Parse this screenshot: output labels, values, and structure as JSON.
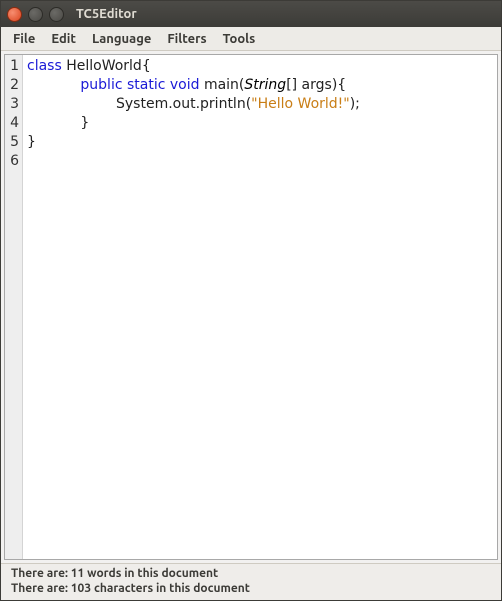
{
  "window": {
    "title": "TC5Editor"
  },
  "menu": {
    "file": "File",
    "edit": "Edit",
    "language": "Language",
    "filters": "Filters",
    "tools": "Tools"
  },
  "editor": {
    "line_numbers": [
      "1",
      "2",
      "3",
      "4",
      "5",
      "6"
    ],
    "code": {
      "l1_kw": "class",
      "l1_rest": " HelloWorld{",
      "l2": "",
      "l3_pad": "            ",
      "l3_kw": "public static void",
      "l3_main": " main(",
      "l3_typ": "String",
      "l3_after": "[] args){",
      "l4_pad": "                    System.out.println(",
      "l4_str": "\"Hello World!\"",
      "l4_after": ");",
      "l5": "            }",
      "l6": "}"
    }
  },
  "status": {
    "words": "There are: 11 words in this document",
    "chars": "There are: 103 characters in this document"
  }
}
